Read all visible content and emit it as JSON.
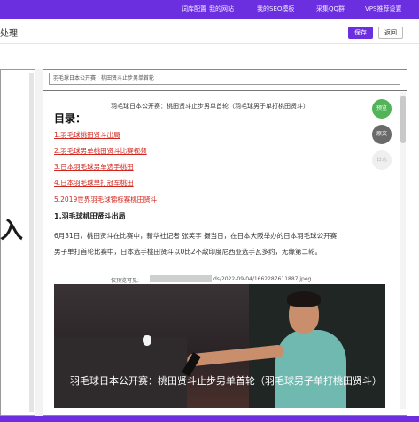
{
  "nav": {
    "items": [
      "词库配置",
      "我的网站",
      "我的SEO模板",
      "采集QQ群",
      "VPS推荐设置"
    ]
  },
  "toolbar": {
    "title": "处理",
    "save_label": "保存",
    "back_label": "返回"
  },
  "left_panel": {
    "glyph": "入"
  },
  "editor": {
    "title_value": "羽毛球日本公开赛：桃田贤斗止步男单首轮",
    "subtitle": "羽毛球日本公开赛：桃田贤斗止步男单首轮（羽毛球男子单打桃田贤斗）",
    "toc_heading": "目录：",
    "toc": [
      "1.羽毛球桃田贤斗出局",
      "2.羽毛球男单桃田贤斗比赛视频",
      "3.日本羽毛球男单选手桃田",
      "4.日本羽毛球单打冠军桃田",
      "5.2019世界羽毛球锦标赛桃田贤斗"
    ],
    "section_heading": "1.羽毛球桃田贤斗出局",
    "paragraph": [
      "6月31日，桃田贤斗在比赛中，新华社记者 张笑宇 摄当日，在日本大阪举办的日本羽毛球公开赛",
      "男子单打首轮比赛中，日本选手桃田贤斗以0比2不敌印度尼西亚选手瓦多约，无缘第二轮。"
    ],
    "image_source_prefix": "仅预览可见:",
    "image_source_suffix": "ds/2022-09-04/1662287611887.jpeg",
    "caption": "羽毛球日本公开赛：桃田贤斗止步男单首轮（羽毛球男子单打桃田贤斗）"
  },
  "side_buttons": {
    "preview": "预览",
    "source": "原文",
    "disabled": "日志"
  },
  "colors": {
    "accent": "#6c2fe0",
    "toc_red": "#d0261d",
    "preview_green": "#52b358"
  }
}
